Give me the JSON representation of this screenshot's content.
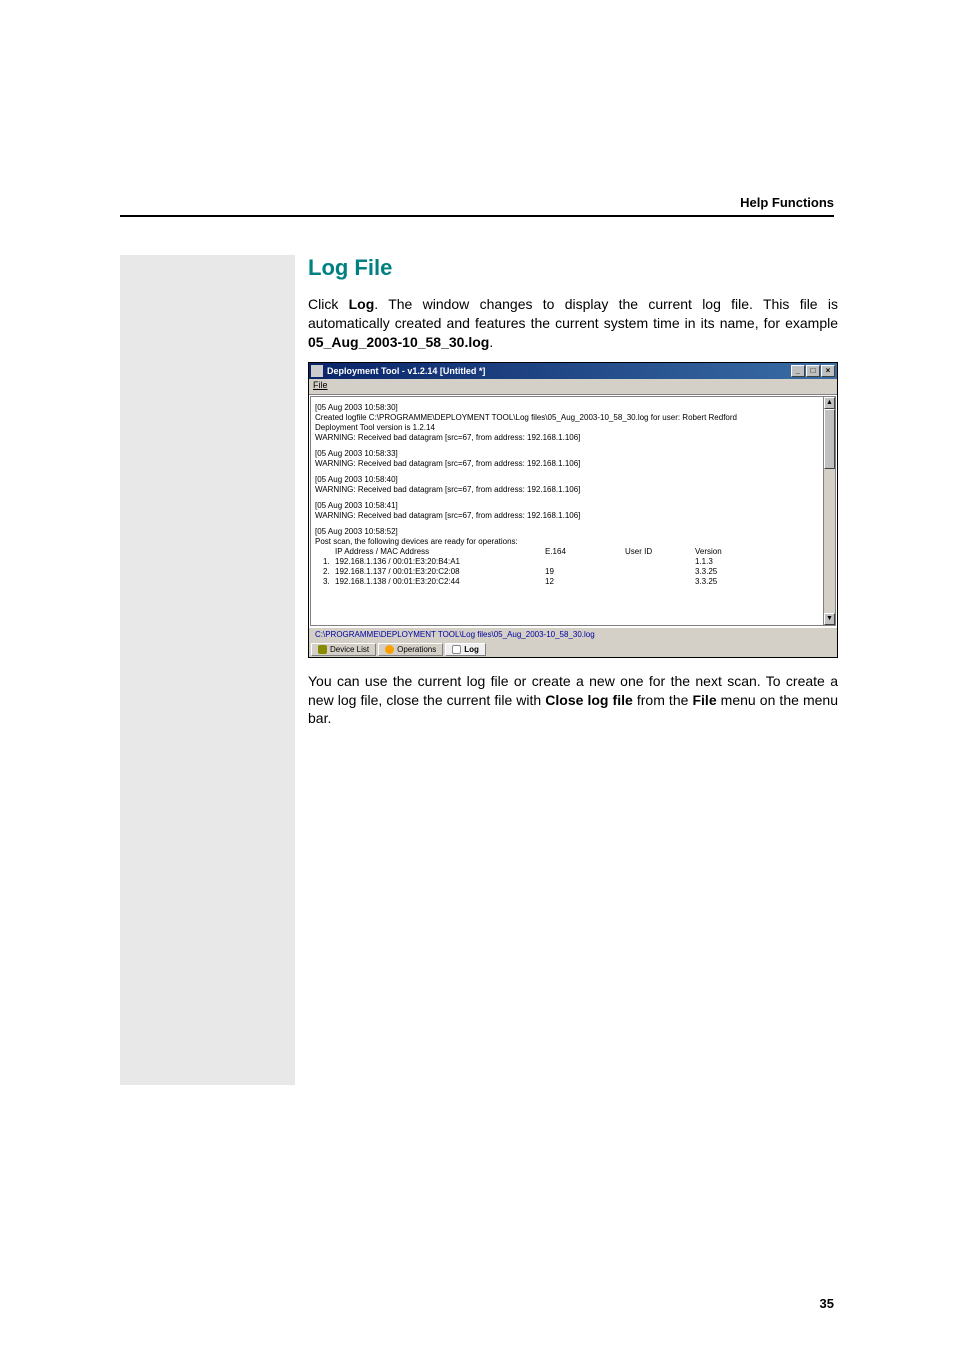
{
  "header": {
    "title": "Help Functions"
  },
  "section": {
    "title": "Log File",
    "intro_pre": "Click ",
    "intro_bold1": "Log",
    "intro_mid": ". The window changes to display the current log file. This file is automatically created and features the current system time in its name, for example ",
    "intro_bold2": "05_Aug_2003-10_58_30.log",
    "intro_end": ".",
    "outro_pre": "You can use the current log file or create a new one for the next scan. To create a new log file, close the current file with ",
    "outro_bold1": "Close log file",
    "outro_mid": " from the ",
    "outro_bold2": "File",
    "outro_end": " menu on the menu bar."
  },
  "app": {
    "title": "Deployment Tool - v1.2.14  [Untitled *]",
    "menu_file": "File",
    "log_path": "C:\\PROGRAMME\\DEPLOYMENT TOOL\\Log files\\05_Aug_2003-10_58_30.log",
    "tabs": {
      "device_list": "Device List",
      "operations": "Operations",
      "log": "Log"
    },
    "win_buttons": {
      "min": "_",
      "max": "□",
      "close": "×"
    },
    "scroll_up": "▲",
    "scroll_down": "▼"
  },
  "log": {
    "entries": [
      {
        "ts": "[05 Aug 2003 10:58:30]",
        "lines": [
          "Created logfile C:\\PROGRAMME\\DEPLOYMENT TOOL\\Log files\\05_Aug_2003-10_58_30.log for user: Robert Redford",
          "Deployment Tool version is 1.2.14",
          "WARNING: Received bad datagram [src=67, from address: 192.168.1.106]"
        ]
      },
      {
        "ts": "[05 Aug 2003 10:58:33]",
        "lines": [
          "WARNING: Received bad datagram [src=67, from address: 192.168.1.106]"
        ]
      },
      {
        "ts": "[05 Aug 2003 10:58:40]",
        "lines": [
          "WARNING: Received bad datagram [src=67, from address: 192.168.1.106]"
        ]
      },
      {
        "ts": "[05 Aug 2003 10:58:41]",
        "lines": [
          "WARNING: Received bad datagram [src=67, from address: 192.168.1.106]"
        ]
      }
    ],
    "scan": {
      "ts": "[05 Aug 2003 10:58:52]",
      "heading": "Post scan, the following devices are ready for operations:",
      "columns": {
        "addr": "IP Address / MAC Address",
        "e164": "E.164",
        "uid": "User ID",
        "ver": "Version"
      },
      "rows": [
        {
          "num": "1.",
          "addr": "192.168.1.136 / 00:01:E3:20:B4:A1",
          "e164": "",
          "uid": "",
          "ver": "1.1.3"
        },
        {
          "num": "2.",
          "addr": "192.168.1.137 / 00:01:E3:20:C2:08",
          "e164": "19",
          "uid": "",
          "ver": "3.3.25"
        },
        {
          "num": "3.",
          "addr": "192.168.1.138 / 00:01:E3:20:C2:44",
          "e164": "12",
          "uid": "",
          "ver": "3.3.25"
        }
      ]
    }
  },
  "page_number": "35"
}
